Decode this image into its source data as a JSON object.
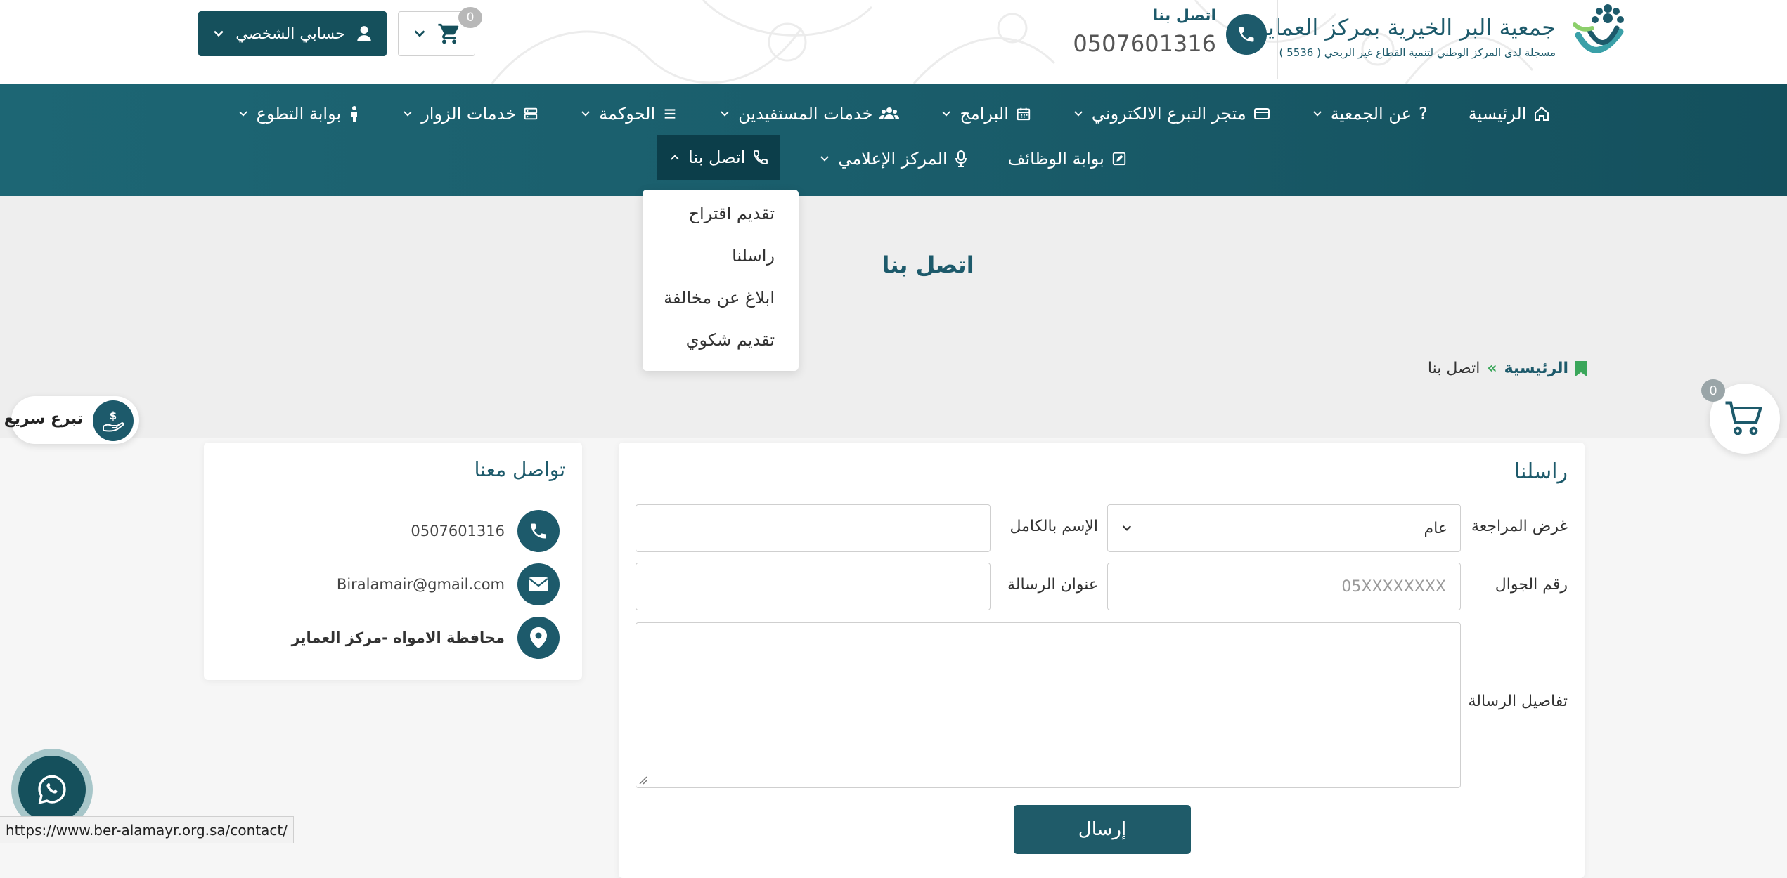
{
  "header": {
    "logo_title": "جمعية البر الخيرية بمركز العماير",
    "logo_subtitle": "مسجلة لدى المركز الوطني لتنمية القطاع غير الربحي ( 5536 )",
    "contact_label": "اتصل بنا",
    "contact_phone": "0507601316",
    "account_label": "حسابي الشخصي",
    "cart_count": "0"
  },
  "nav": {
    "row1": [
      {
        "label": "الرئيسية",
        "icon": "home-icon",
        "dropdown": false
      },
      {
        "label": "عن الجمعية",
        "icon": "question-icon",
        "dropdown": true
      },
      {
        "label": "متجر التبرع الالكتروني",
        "icon": "credit-card-icon",
        "dropdown": true
      },
      {
        "label": "البرامج",
        "icon": "calendar-icon",
        "dropdown": true
      },
      {
        "label": "خدمات المستفيدين",
        "icon": "users-icon",
        "dropdown": true
      },
      {
        "label": "الحوكمة",
        "icon": "list-icon",
        "dropdown": true
      },
      {
        "label": "خدمات الزوار",
        "icon": "server-icon",
        "dropdown": true
      },
      {
        "label": "بوابة التطوع",
        "icon": "person-icon",
        "dropdown": true
      }
    ],
    "row2": [
      {
        "label": "بوابة الوظائف",
        "icon": "edit-square-icon",
        "dropdown": false
      },
      {
        "label": "المركز الإعلامي",
        "icon": "microphone-icon",
        "dropdown": true
      },
      {
        "label": "اتصل بنا",
        "icon": "phone-icon",
        "dropdown": true,
        "active": true
      }
    ]
  },
  "dropdown": {
    "items": [
      "تقديم اقتراح",
      "راسلنا",
      "ابلاغ عن مخالفة",
      "تقديم شكوي"
    ]
  },
  "page": {
    "title": "اتصل بنا",
    "breadcrumb_home": "الرئيسية",
    "breadcrumb_sep": "»",
    "breadcrumb_current": "اتصل بنا"
  },
  "quick_donate": {
    "label": "تبرع سريع"
  },
  "floating_cart": {
    "count": "0"
  },
  "contact_info": {
    "title": "تواصل معنا",
    "phone": "0507601316",
    "email": "Biralamair@gmail.com",
    "address": "محافظة الامواه -مركز العماير"
  },
  "form": {
    "title": "راسلنا",
    "purpose_label": "غرض المراجعة",
    "purpose_value": "عام",
    "fullname_label": "الإسم بالكامل",
    "fullname_value": "",
    "mobile_label": "رقم الجوال",
    "mobile_placeholder": "05XXXXXXXX",
    "subject_label": "عنوان الرسالة",
    "subject_value": "",
    "details_label": "تفاصيل الرسالة",
    "submit_label": "إرسال"
  },
  "status_bar": {
    "url": "https://www.ber-alamayr.org.sa/contact/"
  },
  "colors": {
    "primary": "#1d5a6b",
    "nav_bg": "#1a5d6b",
    "active_nav": "#0c3e4a",
    "breadcrumb_accent": "#3aa65a"
  }
}
